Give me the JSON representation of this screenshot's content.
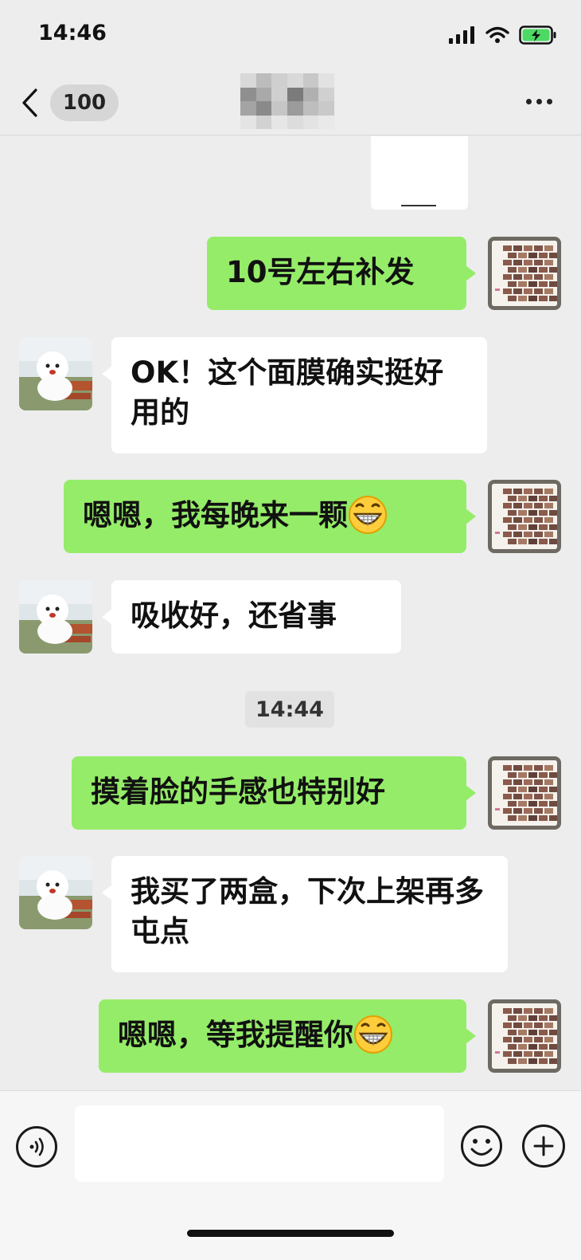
{
  "status_bar": {
    "time": "14:46"
  },
  "nav": {
    "unread_count": "100",
    "title": ""
  },
  "messages": [
    {
      "side": "right",
      "text": "10号左右补发",
      "emoji": false
    },
    {
      "side": "left",
      "text": "OK！这个面膜确实挺好用的",
      "emoji": false
    },
    {
      "side": "right",
      "text": "嗯嗯，我每晚来一颗",
      "emoji": true
    },
    {
      "side": "left",
      "text": "吸收好，还省事",
      "emoji": false
    },
    {
      "side": "right",
      "text": "摸着脸的手感也特别好",
      "emoji": false
    },
    {
      "side": "left",
      "text": "我买了两盒，下次上架再多屯点",
      "emoji": false
    },
    {
      "side": "right",
      "text": "嗯嗯，等我提醒你",
      "emoji": true
    }
  ],
  "timestamp": "14:44",
  "input": {
    "value": "",
    "placeholder": ""
  },
  "icons": {
    "back": "chevron-left-icon",
    "more": "more-dots-icon",
    "voice": "voice-icon",
    "emoji": "smiley-icon",
    "plus": "plus-icon",
    "grin": "grinning-emoji-icon"
  },
  "colors": {
    "sent_bubble": "#95ec69",
    "received_bubble": "#ffffff",
    "background": "#ededed"
  }
}
